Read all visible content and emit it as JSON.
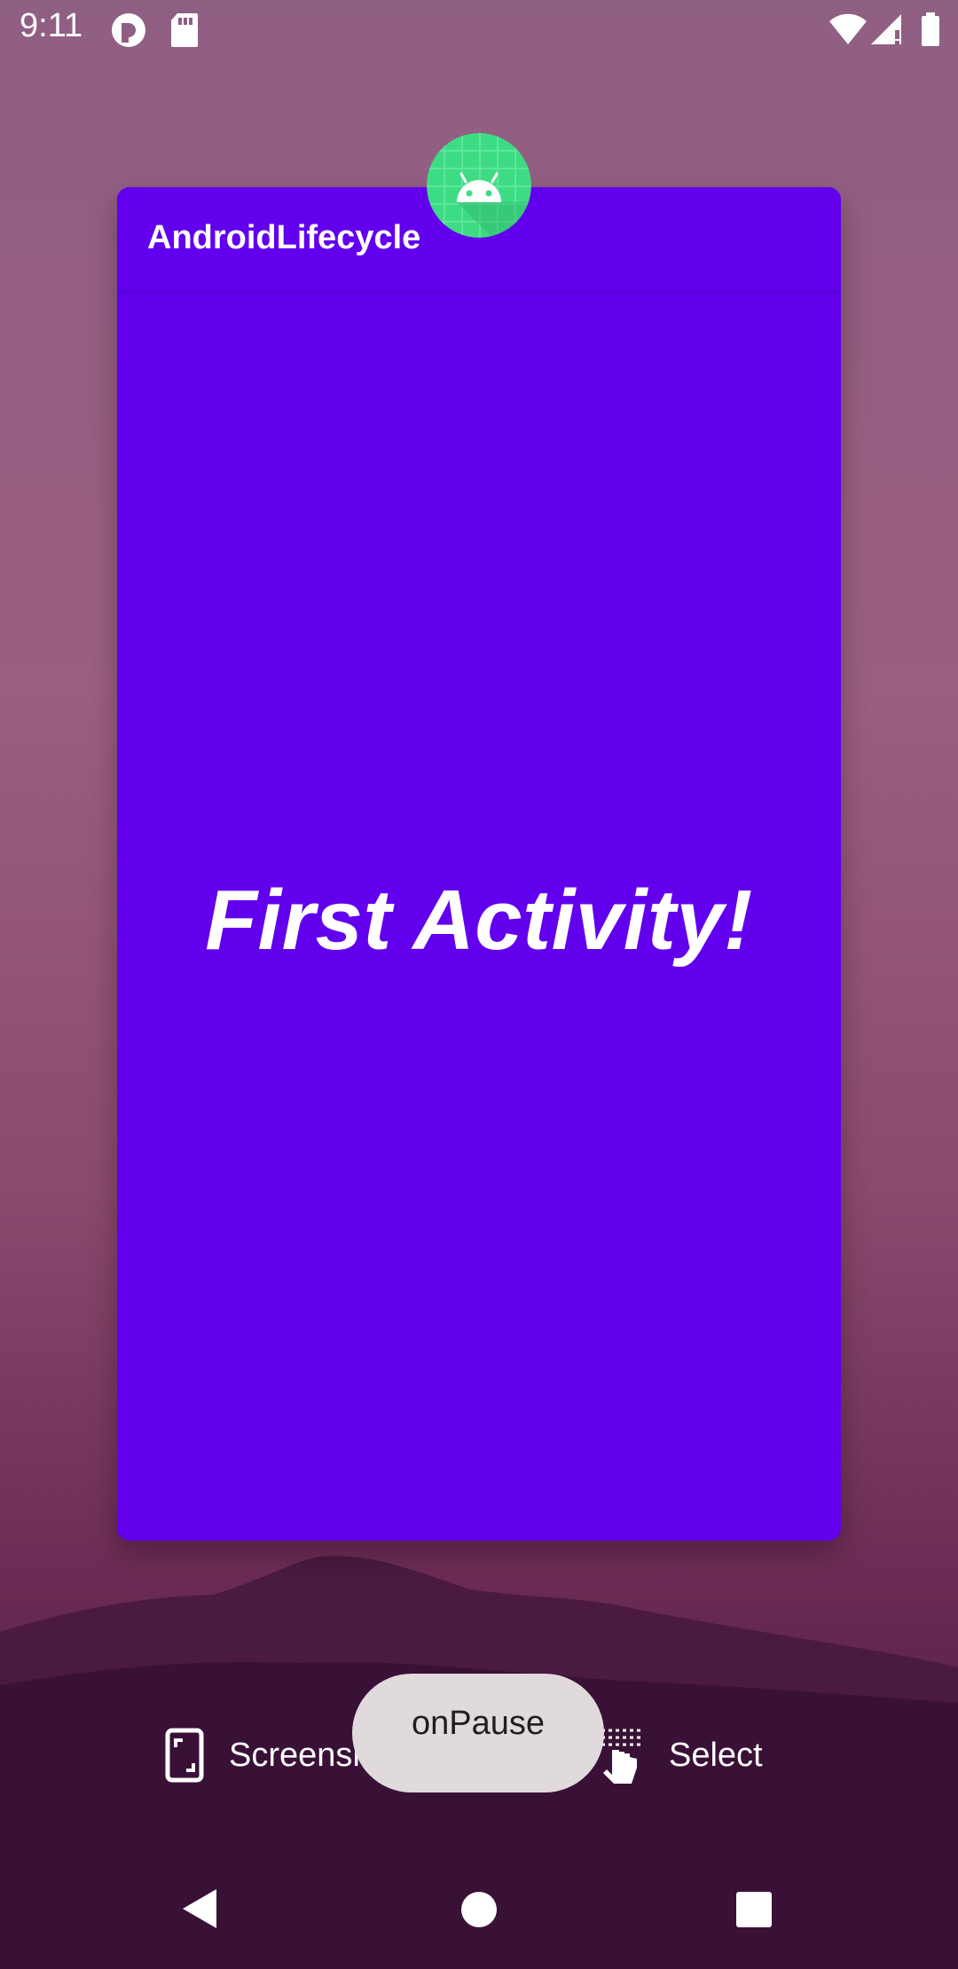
{
  "status_bar": {
    "time": "9:11",
    "icons": [
      "pocket-casts-icon",
      "sd-card-icon",
      "wifi-icon",
      "signal-icon",
      "battery-icon"
    ]
  },
  "recents": {
    "card": {
      "app_title": "AndroidLifecycle",
      "heading": "First Activity!",
      "background_color": "#6200ee",
      "app_icon": "android-app-icon"
    },
    "actions": {
      "screenshot_label": "Screenshot",
      "select_label": "Select"
    }
  },
  "toast": {
    "text": "onPause"
  },
  "nav_bar": {
    "buttons": [
      "back-icon",
      "home-icon",
      "recents-icon"
    ]
  }
}
